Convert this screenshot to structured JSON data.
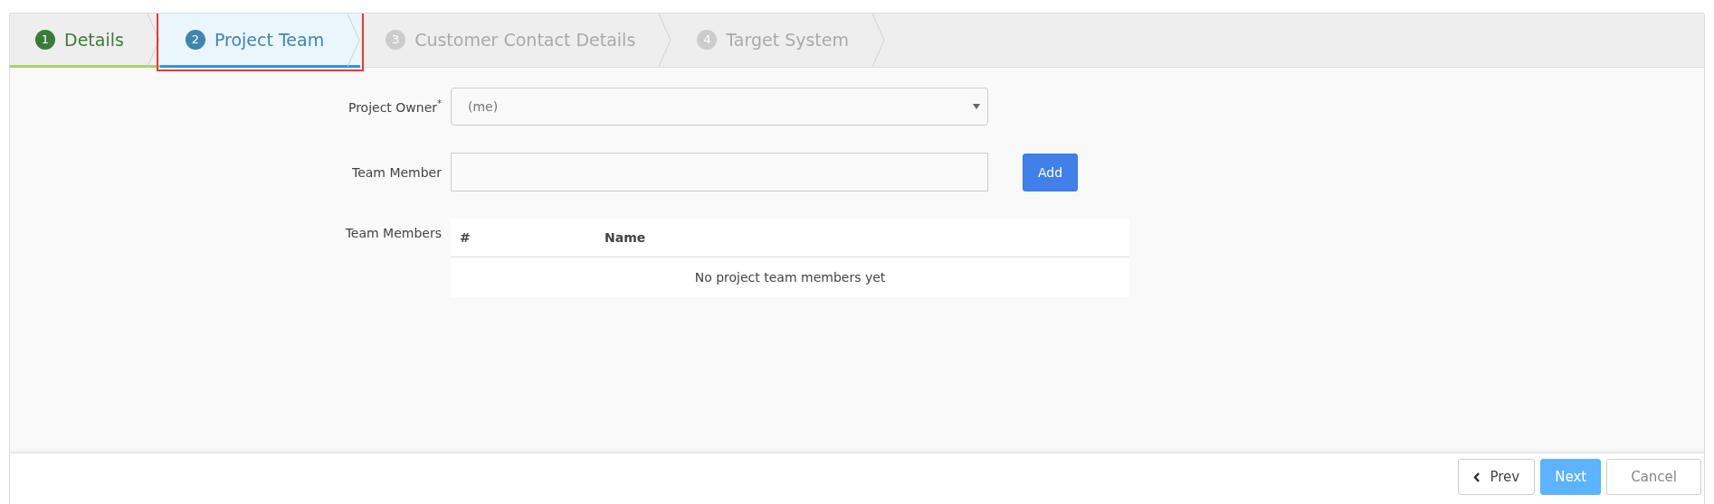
{
  "steps": [
    {
      "number": "1",
      "label": "Details",
      "completed": true,
      "selected": false,
      "highlighted": false
    },
    {
      "number": "2",
      "label": "Project Team",
      "completed": false,
      "selected": true,
      "highlighted": true
    },
    {
      "number": "3",
      "label": "Customer Contact Details",
      "completed": false,
      "selected": false,
      "highlighted": false
    },
    {
      "number": "4",
      "label": "Target System",
      "completed": false,
      "selected": false,
      "highlighted": false
    }
  ],
  "form": {
    "project_owner": {
      "label": "Project Owner",
      "required_mark": "*",
      "value": "(me)"
    },
    "team_member": {
      "label": "Team Member",
      "button": "Add"
    },
    "team_members": {
      "label": "Team Members",
      "columns": [
        "#",
        "Name"
      ],
      "empty_text": "No project team members yet"
    }
  },
  "footer": {
    "buttons": [
      {
        "label": "Prev",
        "kind": "prev"
      },
      {
        "label": "Next",
        "kind": "primary"
      },
      {
        "label": "Cancel",
        "kind": "plain"
      }
    ]
  }
}
